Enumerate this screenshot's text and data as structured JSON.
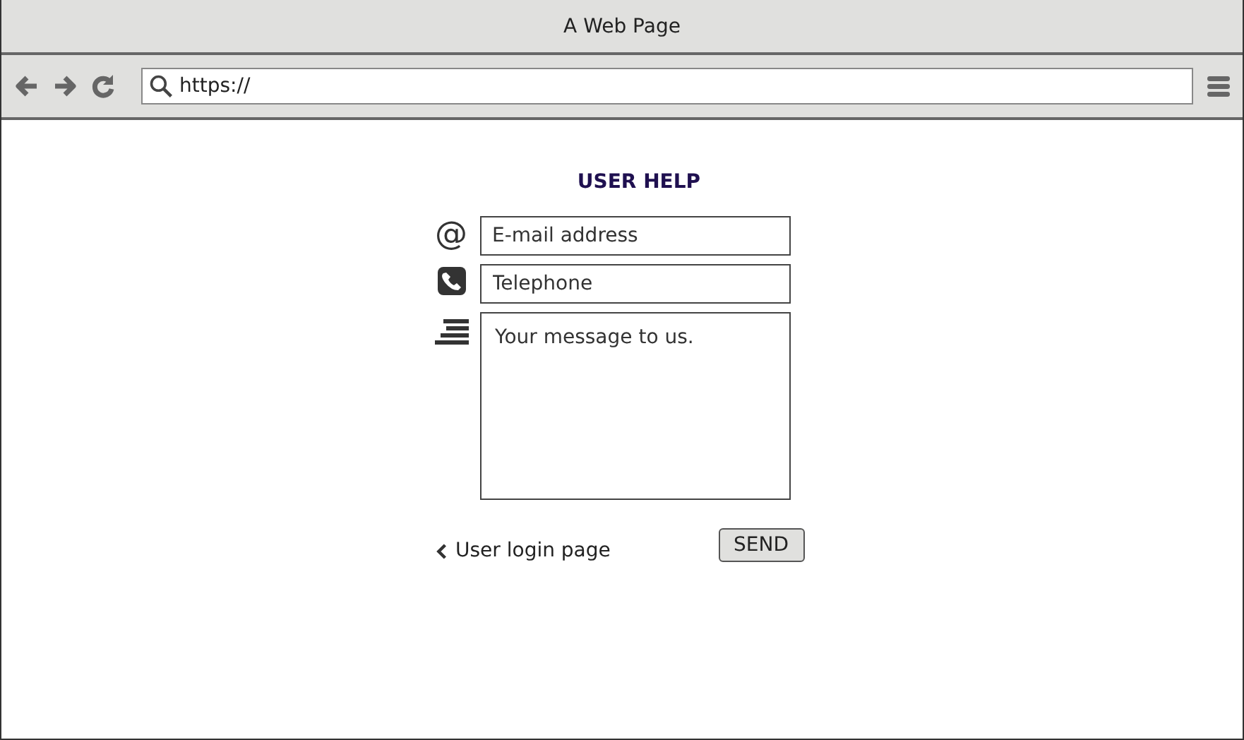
{
  "window": {
    "title": "A Web Page"
  },
  "address_bar": {
    "value": "https://"
  },
  "form": {
    "title": "USER HELP",
    "fields": [
      {
        "kind": "email",
        "icon": "@",
        "placeholder": "E-mail address"
      },
      {
        "kind": "phone",
        "placeholder": "Telephone"
      },
      {
        "kind": "message",
        "placeholder": "Your message to us."
      }
    ],
    "back_link": "User login page",
    "send_button": "SEND"
  }
}
